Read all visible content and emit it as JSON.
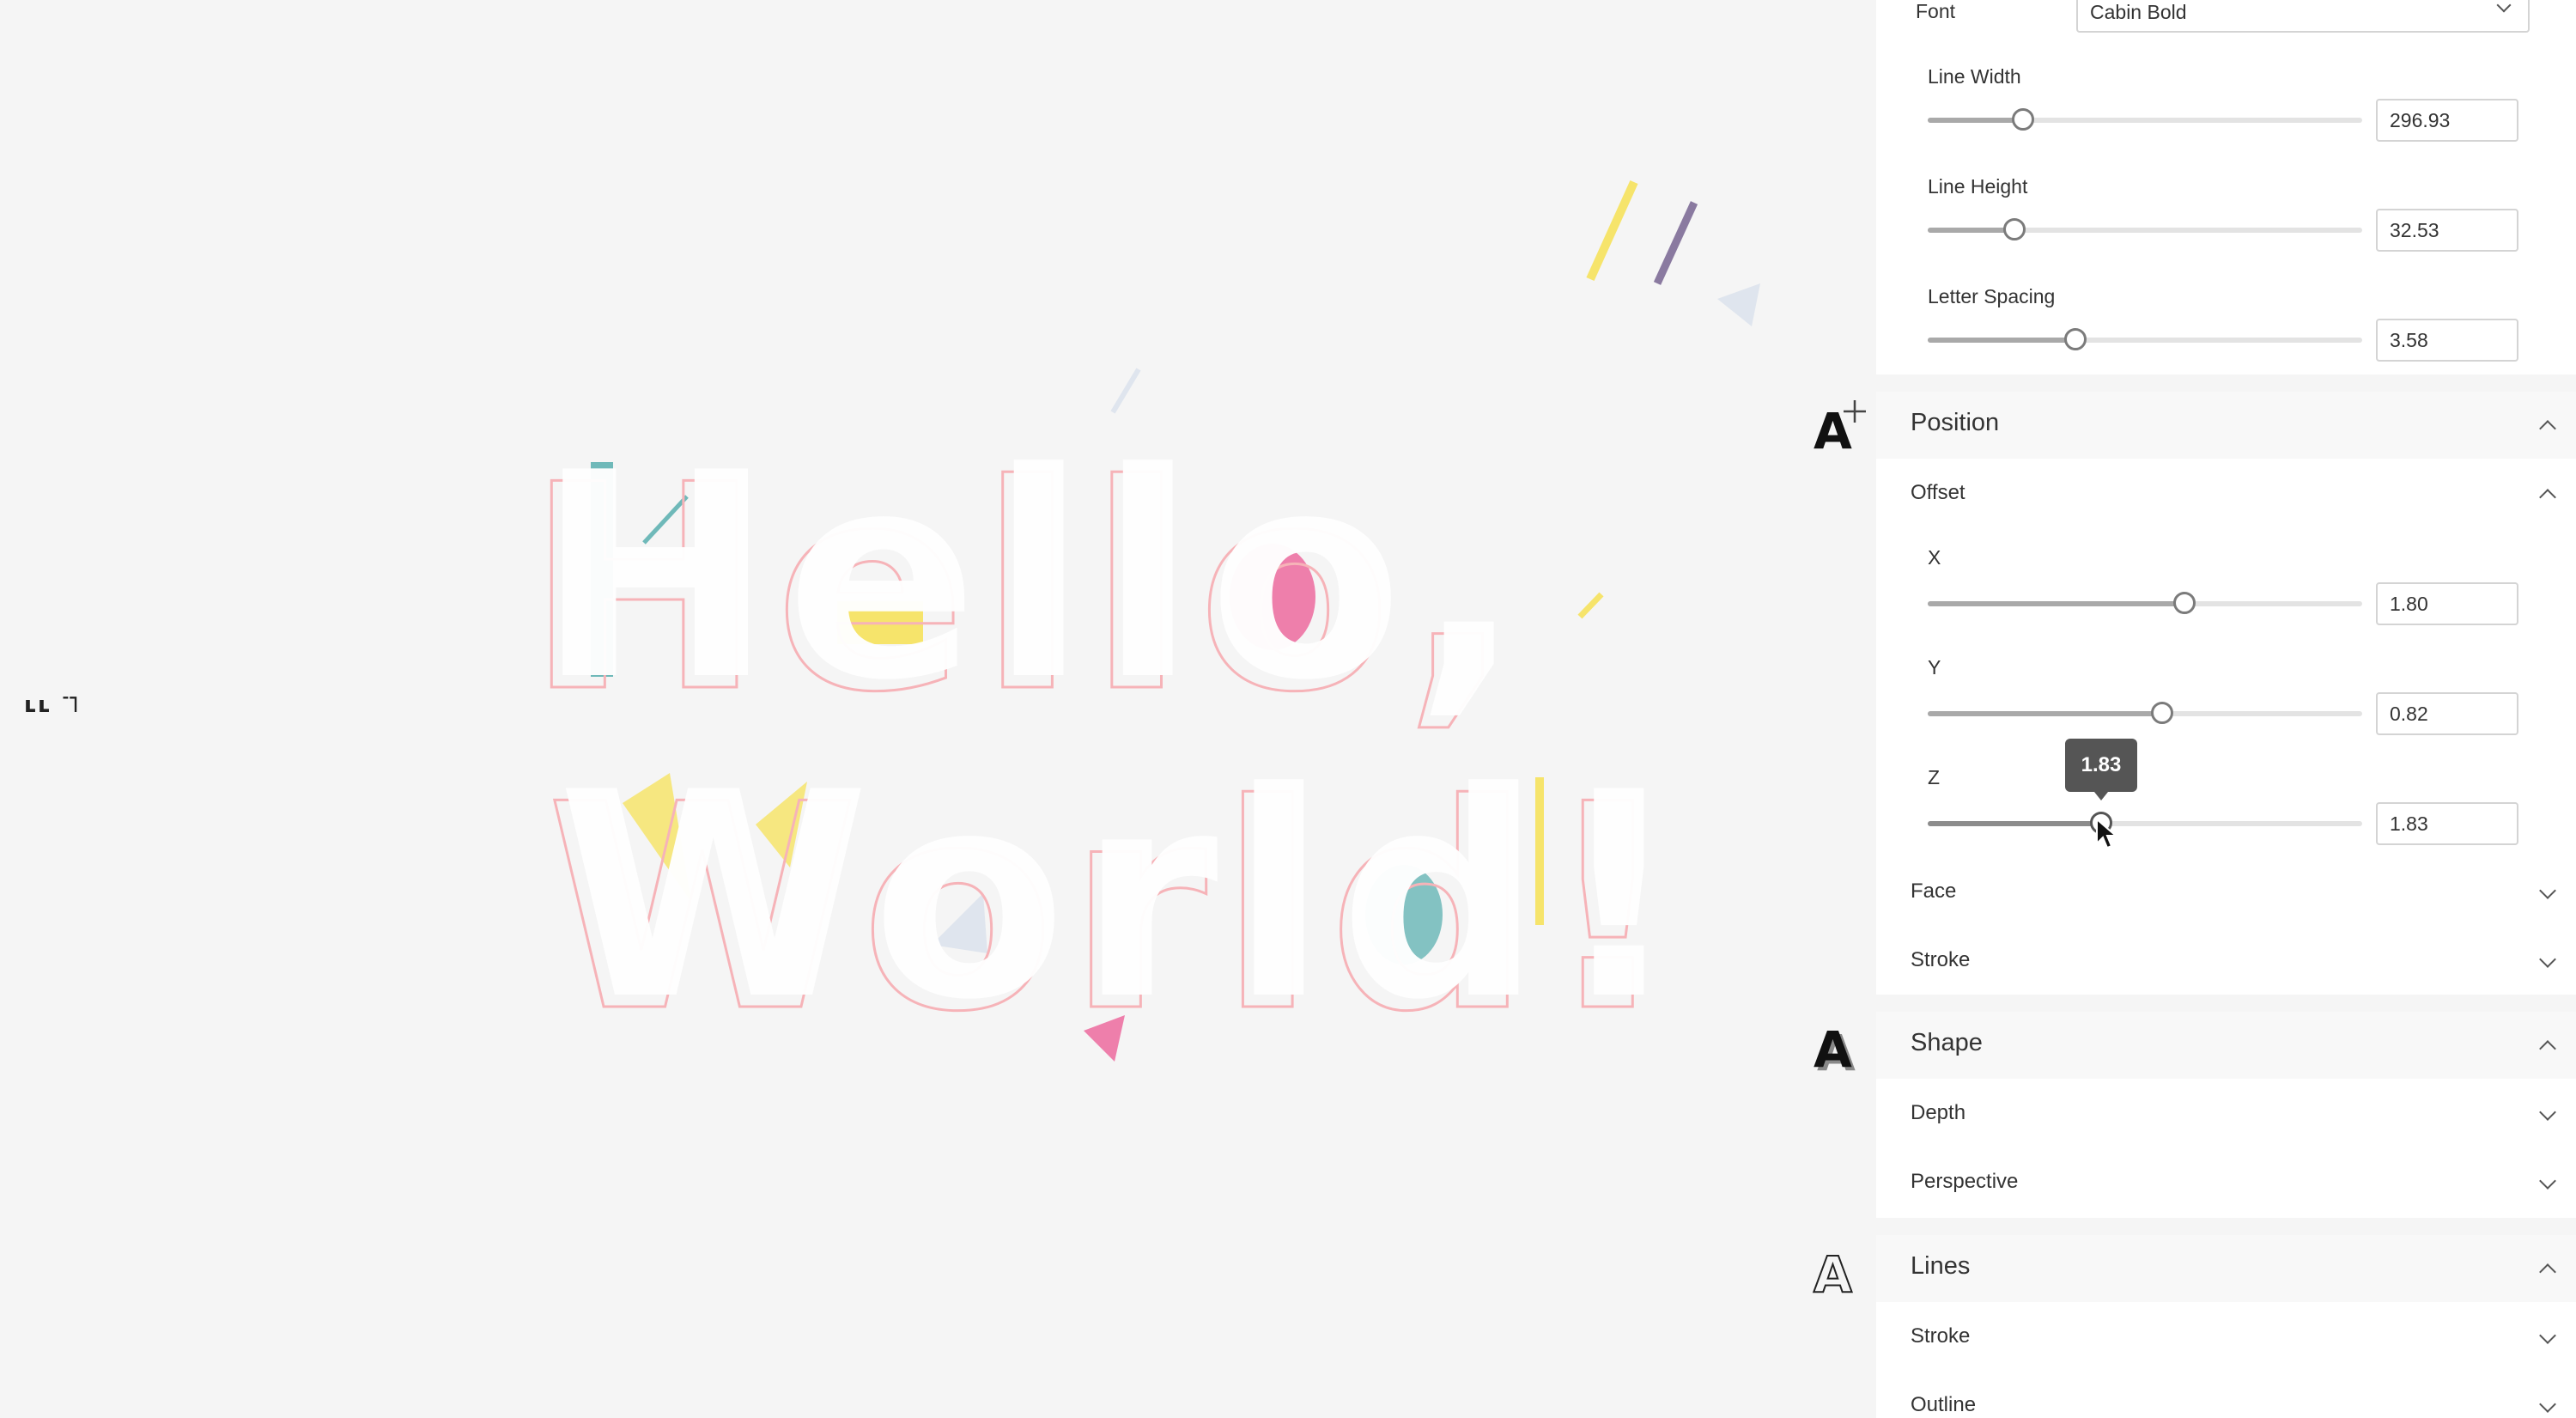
{
  "canvas": {
    "text_line1": "Hello,",
    "text_line2": "World!",
    "side_glyph": "ʟʟ ˥˥",
    "colors": {
      "face": "#ffffff",
      "stroke": "#f6b3b8",
      "teal": "#6fb9b9",
      "yellow": "#f6e46b",
      "pink": "#ee7fab",
      "purple": "#8a7aa0",
      "pale_blue": "#dfe5ee"
    }
  },
  "text_panel": {
    "font_label": "Font",
    "font_value": "Cabin Bold",
    "line_width": {
      "label": "Line Width",
      "value": "296.93",
      "fraction": 0.22
    },
    "line_height": {
      "label": "Line Height",
      "value": "32.53",
      "fraction": 0.2
    },
    "letter_spacing": {
      "label": "Letter Spacing",
      "value": "3.58",
      "fraction": 0.34
    }
  },
  "position": {
    "title": "Position",
    "offset": {
      "title": "Offset",
      "x": {
        "label": "X",
        "value": "1.80",
        "fraction": 0.59
      },
      "y": {
        "label": "Y",
        "value": "0.82",
        "fraction": 0.54
      },
      "z": {
        "label": "Z",
        "value": "1.83",
        "fraction": 0.4,
        "tooltip": "1.83"
      }
    },
    "face_label": "Face",
    "stroke_label": "Stroke"
  },
  "shape": {
    "title": "Shape",
    "depth_label": "Depth",
    "perspective_label": "Perspective"
  },
  "lines": {
    "title": "Lines",
    "stroke_label": "Stroke",
    "outline_label": "Outline"
  },
  "icons": {
    "position": "position-a-move-icon",
    "shape": "shape-a-shadow-icon",
    "lines": "lines-a-outline-icon"
  }
}
